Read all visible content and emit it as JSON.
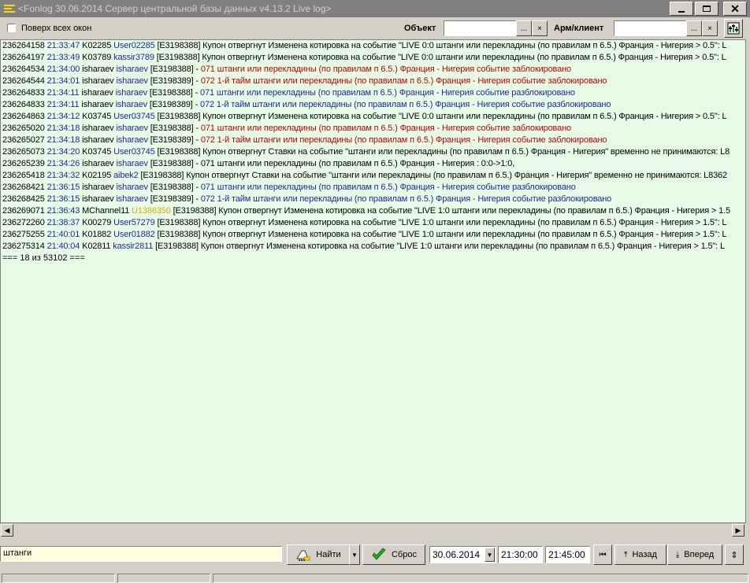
{
  "window": {
    "title": "Fonlog 30.06.2014 Сервер центральной базы данных v4.13.2 Live log>",
    "title_prefix": "<",
    "buttons": [
      "minimize-button",
      "maximize-button",
      "close-button"
    ]
  },
  "toolbar": {
    "on_top_label": "Поверх всех окон",
    "object_label": "Объект",
    "object_value": "",
    "arm_label": "Арм/клиент",
    "arm_value": "",
    "browse_label": "...",
    "clear_label": "×"
  },
  "log": {
    "lines": [
      [
        {
          "t": "236264158 "
        },
        {
          "t": "21:33:47",
          "c": "blue"
        },
        {
          "t": " K02285 "
        },
        {
          "t": "User02285",
          "c": "blue"
        },
        {
          "t": " [E3198388] Купон отвергнут  Изменена котировка на событие \"LIVE 0:0 штанги или перекладины (по правилам п 6.5.) Франция - Нигерия > 0.5\": L"
        }
      ],
      [
        {
          "t": "236264197 "
        },
        {
          "t": "21:33:49",
          "c": "blue"
        },
        {
          "t": " K03789 "
        },
        {
          "t": "kassir3789",
          "c": "blue"
        },
        {
          "t": " [E3198388] Купон отвергнут  Изменена котировка на событие \"LIVE 0:0 штанги или перекладины (по правилам п 6.5.) Франция - Нигерия > 0.5\": L"
        }
      ],
      [
        {
          "t": "236264534 "
        },
        {
          "t": "21:34:00",
          "c": "blue"
        },
        {
          "t": " isharaev "
        },
        {
          "t": "isharaev",
          "c": "blue"
        },
        {
          "t": " [E3198388] -  "
        },
        {
          "t": "071 штанги или перекладины (по правилам п 6.5.) Франция - Нигерия событие заблокировано",
          "c": "red"
        }
      ],
      [
        {
          "t": "236264544 "
        },
        {
          "t": "21:34:01",
          "c": "blue"
        },
        {
          "t": " isharaev "
        },
        {
          "t": "isharaev",
          "c": "blue"
        },
        {
          "t": " [E3198389] -  "
        },
        {
          "t": "072 1-й тайм штанги или перекладины (по правилам п 6.5.) Франция - Нигерия событие заблокировано",
          "c": "red"
        }
      ],
      [
        {
          "t": "236264833 "
        },
        {
          "t": "21:34:11",
          "c": "blue"
        },
        {
          "t": " isharaev "
        },
        {
          "t": "isharaev",
          "c": "blue"
        },
        {
          "t": " [E3198388] -  "
        },
        {
          "t": "071 штанги или перекладины (по правилам п 6.5.) Франция - Нигерия событие разблокировано",
          "c": "blue"
        }
      ],
      [
        {
          "t": "236264833 "
        },
        {
          "t": "21:34:11",
          "c": "blue"
        },
        {
          "t": " isharaev "
        },
        {
          "t": "isharaev",
          "c": "blue"
        },
        {
          "t": " [E3198389] -  "
        },
        {
          "t": "072 1-й тайм штанги или перекладины (по правилам п 6.5.) Франция - Нигерия событие разблокировано",
          "c": "blue"
        }
      ],
      [
        {
          "t": "236264863 "
        },
        {
          "t": "21:34:12",
          "c": "blue"
        },
        {
          "t": " K03745 "
        },
        {
          "t": "User03745",
          "c": "blue"
        },
        {
          "t": " [E3198388] Купон отвергнут  Изменена котировка на событие \"LIVE 0:0 штанги или перекладины (по правилам п 6.5.) Франция - Нигерия > 0.5\": L"
        }
      ],
      [
        {
          "t": "236265020 "
        },
        {
          "t": "21:34:18",
          "c": "blue"
        },
        {
          "t": " isharaev "
        },
        {
          "t": "isharaev",
          "c": "blue"
        },
        {
          "t": " [E3198388] -  "
        },
        {
          "t": "071 штанги или перекладины (по правилам п 6.5.) Франция - Нигерия событие заблокировано",
          "c": "red"
        }
      ],
      [
        {
          "t": "236265027 "
        },
        {
          "t": "21:34:18",
          "c": "blue"
        },
        {
          "t": " isharaev "
        },
        {
          "t": "isharaev",
          "c": "blue"
        },
        {
          "t": " [E3198389] -  "
        },
        {
          "t": "072 1-й тайм штанги или перекладины (по правилам п 6.5.) Франция - Нигерия событие заблокировано",
          "c": "red"
        }
      ],
      [
        {
          "t": "236265073 "
        },
        {
          "t": "21:34:20",
          "c": "blue"
        },
        {
          "t": " K03745 "
        },
        {
          "t": "User03745",
          "c": "blue"
        },
        {
          "t": " [E3198388] Купон отвергнут  Ставки на событие \"штанги или перекладины (по правилам п 6.5.) Франция - Нигерия\" временно не принимаются: L8"
        }
      ],
      [
        {
          "t": "236265239 "
        },
        {
          "t": "21:34:26",
          "c": "blue"
        },
        {
          "t": " isharaev "
        },
        {
          "t": "isharaev",
          "c": "blue"
        },
        {
          "t": " [E3198388] -  071 штанги или перекладины (по правилам п 6.5.) Франция - Нигерия : 0:0->1:0,"
        }
      ],
      [
        {
          "t": "236265418 "
        },
        {
          "t": "21:34:32",
          "c": "blue"
        },
        {
          "t": " K02195 "
        },
        {
          "t": "aibek2",
          "c": "blue"
        },
        {
          "t": " [E3198388] Купон отвергнут  Ставки на событие \"штанги или перекладины (по правилам п 6.5.) Франция - Нигерия\" временно не принимаются: L8362"
        }
      ],
      [
        {
          "t": "236268421 "
        },
        {
          "t": "21:36:15",
          "c": "blue"
        },
        {
          "t": " isharaev "
        },
        {
          "t": "isharaev",
          "c": "blue"
        },
        {
          "t": " [E3198388] -  "
        },
        {
          "t": "071 штанги или перекладины (по правилам п 6.5.) Франция - Нигерия событие разблокировано",
          "c": "blue"
        }
      ],
      [
        {
          "t": "236268425 "
        },
        {
          "t": "21:36:15",
          "c": "blue"
        },
        {
          "t": " isharaev "
        },
        {
          "t": "isharaev",
          "c": "blue"
        },
        {
          "t": " [E3198389] -  "
        },
        {
          "t": "072 1-й тайм штанги или перекладины (по правилам п 6.5.) Франция - Нигерия событие разблокировано",
          "c": "blue"
        }
      ],
      [
        {
          "t": "236269071 "
        },
        {
          "t": "21:36:43",
          "c": "blue"
        },
        {
          "t": " MChannel11 "
        },
        {
          "t": "U1386350",
          "c": "yel"
        },
        {
          "t": " [E3198388] Купон отвергнут  Изменена котировка на событие \"LIVE 1:0 штанги или перекладины (по правилам п 6.5.) Франция - Нигерия > 1.5"
        }
      ],
      [
        {
          "t": "236272260 "
        },
        {
          "t": "21:38:37",
          "c": "blue"
        },
        {
          "t": " K00279 "
        },
        {
          "t": "User57279",
          "c": "blue"
        },
        {
          "t": " [E3198388] Купон отвергнут  Изменена котировка на событие \"LIVE 1:0 штанги или перекладины (по правилам п 6.5.) Франция - Нигерия > 1.5\": L"
        }
      ],
      [
        {
          "t": "236275255 "
        },
        {
          "t": "21:40:01",
          "c": "blue"
        },
        {
          "t": " K01882 "
        },
        {
          "t": "User01882",
          "c": "blue"
        },
        {
          "t": " [E3198388] Купон отвергнут  Изменена котировка на событие \"LIVE 1:0 штанги или перекладины (по правилам п 6.5.) Франция - Нигерия > 1.5\": L"
        }
      ],
      [
        {
          "t": "236275314 "
        },
        {
          "t": "21:40:04",
          "c": "blue"
        },
        {
          "t": " K02811 "
        },
        {
          "t": "kassir2811",
          "c": "blue"
        },
        {
          "t": " [E3198388] Купон отвергнут  Изменена котировка на событие \"LIVE 1:0 штанги или перекладины (по правилам п 6.5.) Франция - Нигерия > 1.5\": L"
        }
      ]
    ],
    "footer": "=== 18 из 53102   ==="
  },
  "bottom": {
    "search_value": "штанги",
    "find_label": "Найти",
    "reset_label": "Сброс",
    "date": "30.06.2014",
    "time_from": "21:30:00",
    "time_to": "21:45:00",
    "back_label": "Назад",
    "forward_label": "Вперед"
  },
  "colors": {
    "log_bg": "#e8fbe6",
    "blue": "#1a2a9e",
    "red": "#c00000",
    "yellow": "#d8b000",
    "search_bg": "#ffffe0"
  }
}
